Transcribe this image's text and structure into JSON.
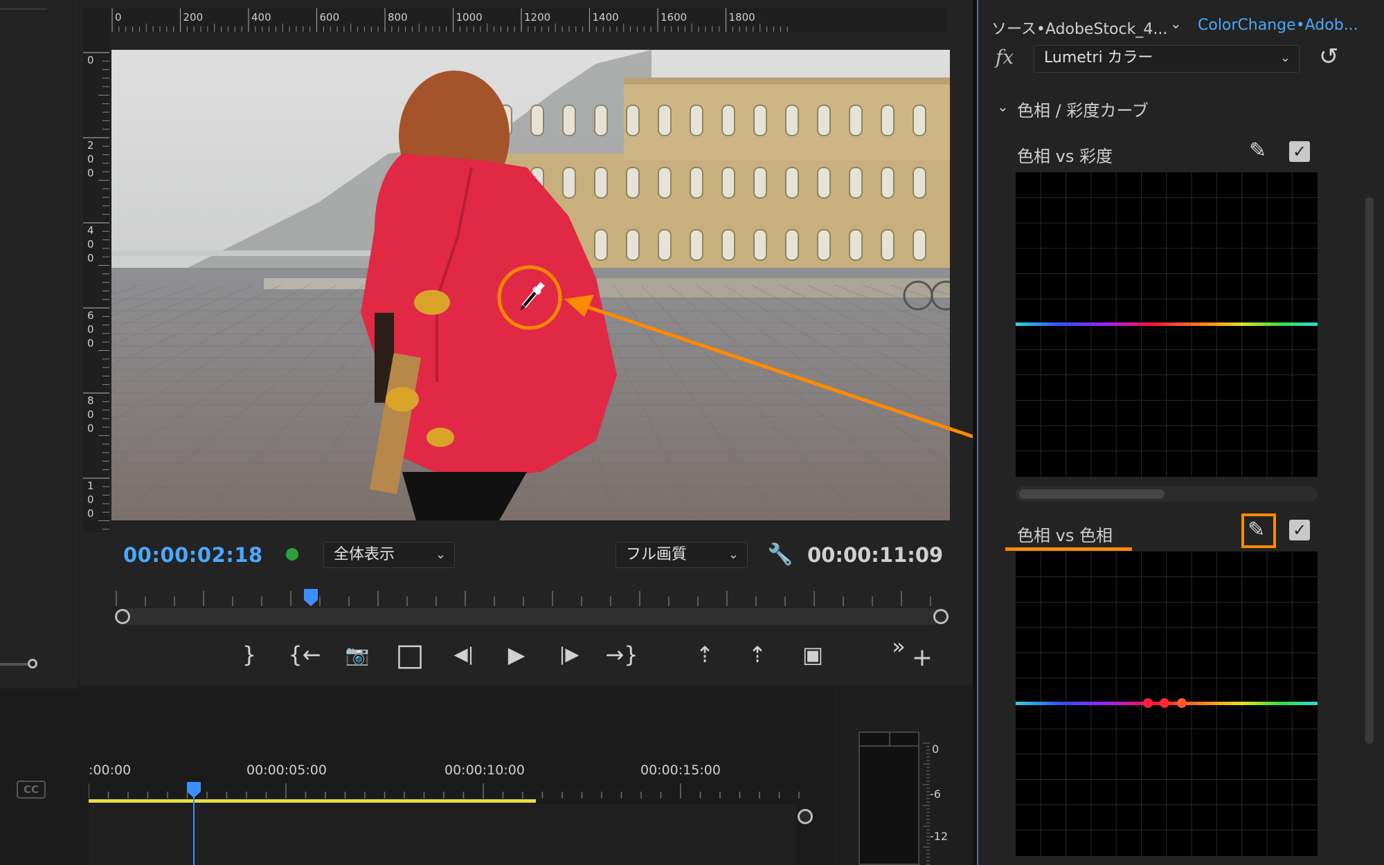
{
  "program_monitor": {
    "ruler_top_labels": [
      "0",
      "200",
      "400",
      "600",
      "800",
      "1000",
      "1200",
      "1400",
      "1600",
      "1800"
    ],
    "ruler_left_labels": [
      "0",
      "200",
      "400",
      "600",
      "800",
      "100"
    ],
    "current_timecode": "00:00:02:18",
    "duration_timecode": "00:00:11:09",
    "zoom_dropdown": "全体表示",
    "quality_dropdown": "フル画質",
    "transport": {
      "mark_out": "}",
      "go_to_in": "{←",
      "camera": "📷",
      "safe_margins": "□",
      "step_back": "◀|",
      "play": "▶",
      "step_forward": "|▶",
      "go_to_out": "→}",
      "lift": "⇡",
      "extract": "⇡",
      "compare": "▣",
      "more": "»",
      "add": "+"
    }
  },
  "lumetri": {
    "source_label": "ソース•AdobeStock_4...",
    "clip_label": "ColorChange•Adob...",
    "fx_label": "fx",
    "effect_name": "Lumetri カラー",
    "section_title": "色相 / 彩度カーブ",
    "curve1_label": "色相 vs 彩度",
    "curve2_label": "色相 vs 色相",
    "checkbox_glyph": "✓"
  },
  "timeline": {
    "cc_label": "CC",
    "times": [
      ":00:00",
      "00:00:05:00",
      "00:00:10:00",
      "00:00:15:00"
    ]
  },
  "meters": {
    "db_labels": [
      "0",
      "-6",
      "-12"
    ]
  },
  "colors": {
    "accent_blue": "#4aa8ff",
    "annotation_orange": "#ff8a00",
    "play_green": "#29a33a",
    "timeline_yellow": "#e9e23a"
  }
}
